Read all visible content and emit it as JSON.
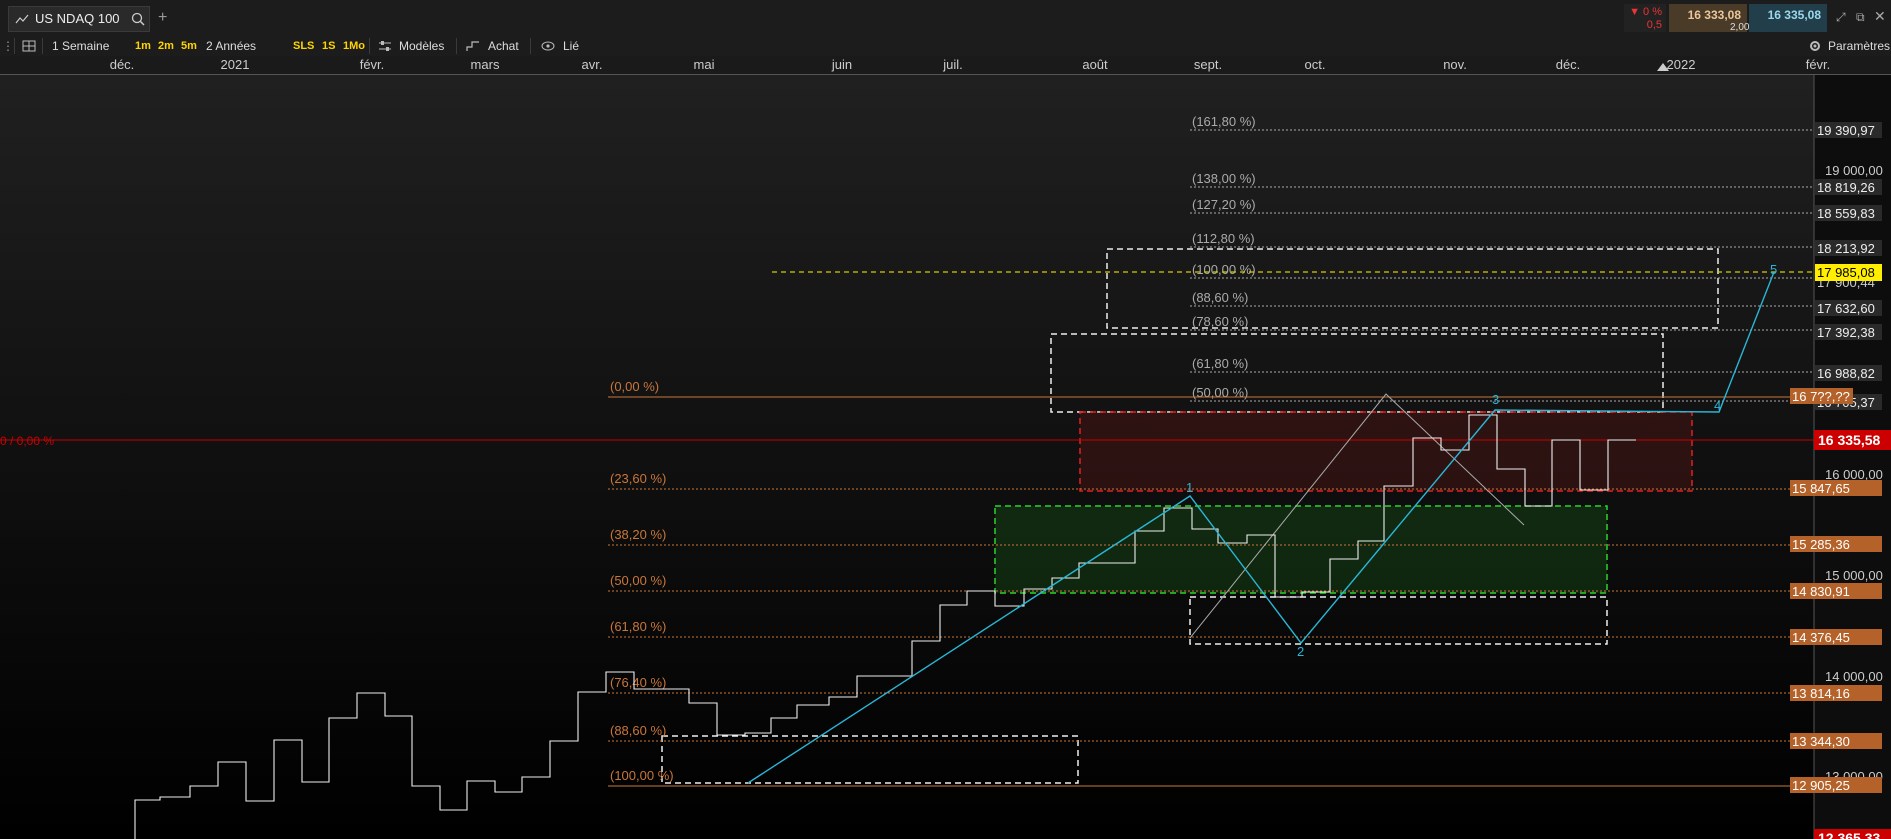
{
  "window": {
    "instrument": "US NDAQ 100",
    "quote_change_pct": "▼ 0 %",
    "quote_change_abs": "0,5",
    "bid": "16 333,08",
    "ask": "16 335,08",
    "spread": "2,00"
  },
  "toolbar": {
    "period": "1 Semaine",
    "quick_1": "1m",
    "quick_2": "2m",
    "quick_3": "5m",
    "range": "2 Années",
    "btn_sls": "SLS",
    "btn_1s": "1S",
    "btn_1mo": "1Mo",
    "models": "Modèles",
    "purchase": "Achat",
    "linked": "Lié",
    "settings": "Paramètres"
  },
  "time_axis": [
    "déc.",
    "2021",
    "févr.",
    "mars",
    "avr.",
    "mai",
    "juin",
    "juil.",
    "août",
    "sept.",
    "oct.",
    "nov.",
    "déc.",
    "2022",
    "févr."
  ],
  "price_axis_labels": [
    "19 390,97",
    "19 000,00",
    "18 819,26",
    "18 559,83",
    "18 213,92",
    "17 900,44",
    "17 632,60",
    "17 392,38",
    "16 988,82",
    "16 705,37",
    "16 000,00",
    "15 000,00",
    "14 000,00",
    "13 000,00"
  ],
  "price_axis_tags": [
    "16 7??,??",
    "15 847,65",
    "15 285,36",
    "14 830,91",
    "14 376,45",
    "13 814,16",
    "13 344,30",
    "12 905,25"
  ],
  "current_price": "16 335,58",
  "target_price": "17 985,08",
  "bottom_price": "12 365,33",
  "left_marker": "0 / 0,00 %",
  "fib_ext_labels": [
    "(161,80 %)",
    "(138,00 %)",
    "(127,20 %)",
    "(112,80 %)",
    "(100,00 %)",
    "(88,60 %)",
    "(78,60 %)",
    "(61,80 %)",
    "(50,00 %)"
  ],
  "fib_ret_labels": [
    "(0,00 %)",
    "(23,60 %)",
    "(38,20 %)",
    "(50,00 %)",
    "(61,80 %)",
    "(76,40 %)",
    "(88,60 %)",
    "(100,00 %)"
  ],
  "wave_labels": [
    "1",
    "2",
    "3",
    "4",
    "5"
  ],
  "colors": {
    "fib_ret": "#c8763a",
    "fib_ext": "#aaaaaa",
    "current": "#cc0000",
    "target": "#ffee00",
    "wave": "#2ab6d6",
    "price_tag": "#b4622a"
  }
}
